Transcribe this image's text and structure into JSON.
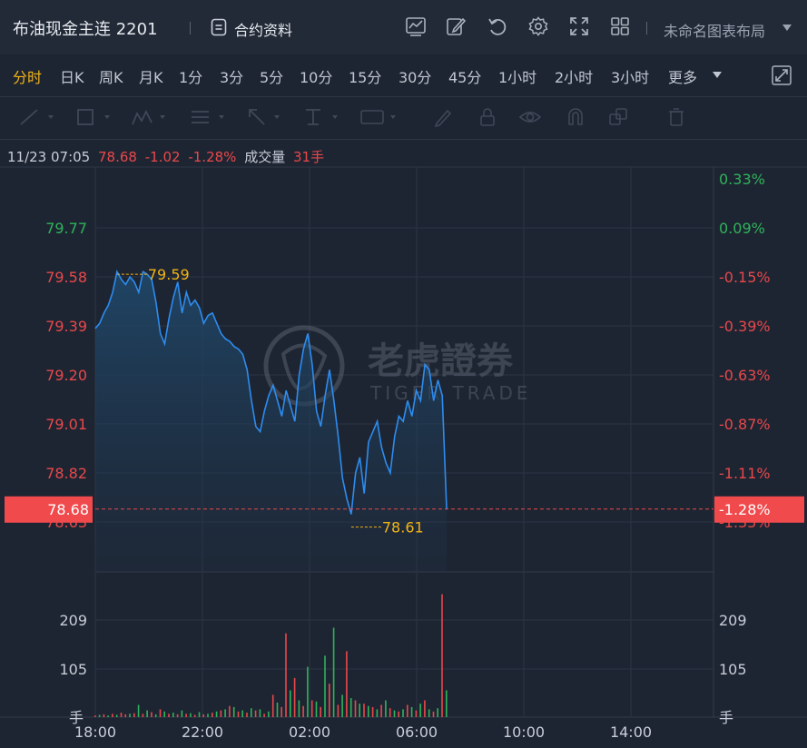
{
  "header": {
    "title": "布油现金主连 2201",
    "contract_label": "合约资料",
    "layout_label": "未命名图表布局"
  },
  "timeframes": [
    "分时",
    "日K",
    "周K",
    "月K",
    "1分",
    "3分",
    "5分",
    "10分",
    "15分",
    "30分",
    "45分",
    "1小时",
    "2小时",
    "3小时",
    "更多"
  ],
  "active_timeframe": "分时",
  "info": {
    "datetime": "11/23 07:05",
    "price": "78.68",
    "change": "-1.02",
    "change_pct": "-1.28%",
    "volume_label": "成交量",
    "volume": "31手"
  },
  "price_axis": [
    "79.77",
    "79.58",
    "79.39",
    "79.20",
    "79.01",
    "78.82",
    "78.63"
  ],
  "pct_axis": [
    "0.33%",
    "0.09%",
    "-0.15%",
    "-0.39%",
    "-0.63%",
    "-0.87%",
    "-1.11%",
    "-1.35%"
  ],
  "current_price_tag": "78.68",
  "current_pct_tag": "-1.28%",
  "high_label": "79.59",
  "low_label": "78.61",
  "watermark": {
    "cn": "老虎證券",
    "en": "TIGER TRADE"
  },
  "volume_axis": [
    "209",
    "105"
  ],
  "volume_unit": "手",
  "time_axis": [
    "18:00",
    "22:00",
    "02:00",
    "06:00",
    "10:00",
    "14:00"
  ],
  "colors": {
    "up": "#e8484b",
    "down": "#2fb35a",
    "line": "#2d8cf0",
    "accent": "#f2b416"
  },
  "chart_data": {
    "type": "area",
    "x_range": [
      "18:00",
      "15:00"
    ],
    "ylim": [
      78.55,
      79.96
    ],
    "values": [
      79.38,
      79.4,
      79.44,
      79.47,
      79.52,
      79.6,
      79.57,
      79.55,
      79.58,
      79.56,
      79.52,
      79.6,
      79.59,
      79.57,
      79.48,
      79.36,
      79.32,
      79.42,
      79.5,
      79.56,
      79.44,
      79.52,
      79.47,
      79.49,
      79.46,
      79.4,
      79.43,
      79.44,
      79.4,
      79.36,
      79.34,
      79.33,
      79.31,
      79.3,
      79.28,
      79.22,
      79.1,
      79.0,
      78.98,
      79.06,
      79.12,
      79.16,
      79.1,
      79.04,
      79.14,
      79.08,
      79.02,
      79.2,
      79.3,
      79.36,
      79.24,
      79.06,
      79.0,
      79.12,
      79.22,
      79.1,
      78.96,
      78.8,
      78.72,
      78.66,
      78.82,
      78.88,
      78.74,
      78.94,
      78.98,
      79.02,
      78.92,
      78.86,
      78.82,
      78.96,
      79.04,
      79.02,
      79.1,
      79.04,
      79.14,
      79.1,
      79.24,
      79.22,
      79.1,
      79.18,
      79.12,
      78.68
    ],
    "high": 79.59,
    "low": 78.61,
    "volume_ylim": [
      0,
      260
    ],
    "volume_values": [
      3,
      4,
      5,
      3,
      6,
      4,
      8,
      5,
      6,
      7,
      22,
      6,
      12,
      9,
      5,
      14,
      10,
      6,
      8,
      5,
      12,
      6,
      7,
      4,
      9,
      5,
      6,
      8,
      10,
      12,
      14,
      20,
      18,
      10,
      12,
      8,
      16,
      12,
      14,
      6,
      10,
      40,
      26,
      18,
      150,
      48,
      70,
      30,
      20,
      90,
      30,
      28,
      18,
      110,
      60,
      160,
      22,
      40,
      118,
      34,
      30,
      24,
      24,
      20,
      18,
      14,
      22,
      30,
      16,
      12,
      10,
      14,
      22,
      18,
      12,
      24,
      30,
      14,
      10,
      16,
      220,
      48
    ],
    "volume_dirs": [
      "u",
      "d",
      "u",
      "d",
      "u",
      "d",
      "u",
      "u",
      "d",
      "u",
      "d",
      "u",
      "d",
      "u",
      "d",
      "u",
      "d",
      "u",
      "d",
      "u",
      "d",
      "u",
      "d",
      "u",
      "d",
      "u",
      "d",
      "u",
      "d",
      "u",
      "d",
      "u",
      "d",
      "u",
      "d",
      "u",
      "d",
      "u",
      "d",
      "u",
      "d",
      "u",
      "d",
      "u",
      "u",
      "d",
      "u",
      "d",
      "u",
      "d",
      "u",
      "d",
      "u",
      "d",
      "u",
      "d",
      "u",
      "d",
      "u",
      "d",
      "u",
      "d",
      "u",
      "d",
      "u",
      "d",
      "u",
      "d",
      "u",
      "d",
      "u",
      "d",
      "u",
      "d",
      "u",
      "d",
      "u",
      "d",
      "u",
      "d",
      "u",
      "d"
    ]
  }
}
